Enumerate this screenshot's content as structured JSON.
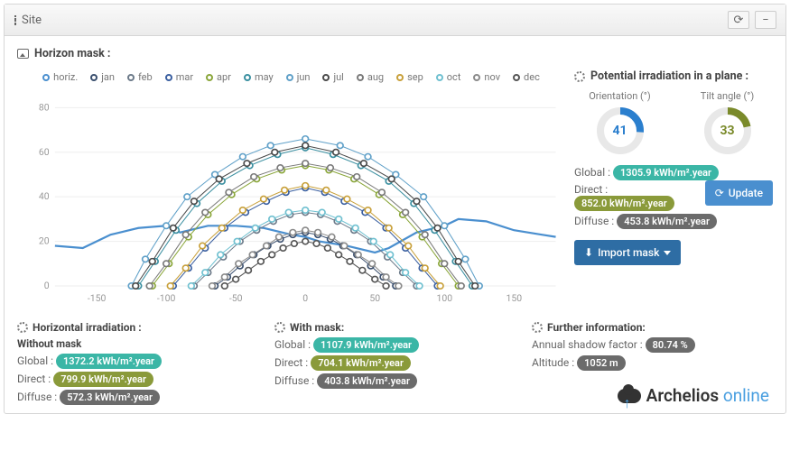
{
  "header": {
    "title": "Site"
  },
  "section_label": "Horizon mask :",
  "legend": [
    {
      "label": "horiz.",
      "color": "#4a8fcf"
    },
    {
      "label": "jan",
      "color": "#3a4f6e"
    },
    {
      "label": "feb",
      "color": "#6c7a89"
    },
    {
      "label": "mar",
      "color": "#3a5fa0"
    },
    {
      "label": "apr",
      "color": "#8aa63a"
    },
    {
      "label": "may",
      "color": "#3a8fa0"
    },
    {
      "label": "jun",
      "color": "#5fa0c8"
    },
    {
      "label": "jul",
      "color": "#4a4a4a"
    },
    {
      "label": "aug",
      "color": "#7a7a7a"
    },
    {
      "label": "sep",
      "color": "#c8a03a"
    },
    {
      "label": "oct",
      "color": "#6fc0d0"
    },
    {
      "label": "nov",
      "color": "#8a8a8a"
    },
    {
      "label": "dec",
      "color": "#555555"
    }
  ],
  "chart_data": {
    "type": "line",
    "xlabel": "",
    "ylabel": "",
    "xlim": [
      -180,
      180
    ],
    "ylim": [
      0,
      85
    ],
    "x_ticks": [
      -150,
      -100,
      -50,
      0,
      50,
      100,
      150
    ],
    "y_ticks": [
      0,
      20,
      40,
      60,
      80
    ],
    "series": [
      {
        "name": "horiz.",
        "color": "#4a8fcf",
        "style": "line",
        "x": [
          -180,
          -160,
          -140,
          -120,
          -100,
          -90,
          -70,
          -50,
          -30,
          -10,
          0,
          10,
          30,
          50,
          60,
          80,
          100,
          110,
          130,
          150,
          170,
          180
        ],
        "y": [
          18,
          17,
          23,
          26,
          27,
          24,
          27,
          27,
          26,
          23,
          22,
          20,
          18,
          15,
          17,
          24,
          27,
          30,
          29,
          25,
          23,
          22
        ]
      },
      {
        "name": "jun",
        "color": "#5fa0c8",
        "style": "markers",
        "x": [
          -125,
          -115,
          -100,
          -85,
          -65,
          -45,
          -25,
          0,
          25,
          45,
          65,
          85,
          100,
          115,
          125
        ],
        "y": [
          0,
          12,
          27,
          40,
          50,
          58,
          63,
          66,
          63,
          58,
          50,
          40,
          27,
          12,
          0
        ]
      },
      {
        "name": "may",
        "color": "#3a8fa0",
        "style": "markers",
        "x": [
          -120,
          -108,
          -93,
          -78,
          -60,
          -40,
          -20,
          0,
          20,
          40,
          60,
          78,
          93,
          108,
          120
        ],
        "y": [
          0,
          11,
          25,
          37,
          47,
          54,
          59,
          62,
          59,
          54,
          47,
          37,
          25,
          11,
          0
        ]
      },
      {
        "name": "jul",
        "color": "#4a4a4a",
        "style": "markers",
        "x": [
          -122,
          -110,
          -95,
          -80,
          -62,
          -42,
          -22,
          0,
          22,
          42,
          62,
          80,
          95,
          110,
          122
        ],
        "y": [
          0,
          11,
          26,
          38,
          48,
          55,
          60,
          63,
          60,
          55,
          48,
          38,
          26,
          11,
          0
        ]
      },
      {
        "name": "apr",
        "color": "#8aa63a",
        "style": "markers",
        "x": [
          -110,
          -98,
          -84,
          -70,
          -53,
          -35,
          -17,
          0,
          17,
          35,
          53,
          70,
          84,
          98,
          110
        ],
        "y": [
          0,
          10,
          22,
          32,
          41,
          48,
          52,
          54,
          52,
          48,
          41,
          32,
          22,
          10,
          0
        ]
      },
      {
        "name": "aug",
        "color": "#7a7a7a",
        "style": "markers",
        "x": [
          -112,
          -100,
          -86,
          -72,
          -55,
          -37,
          -18,
          0,
          18,
          37,
          55,
          72,
          86,
          100,
          112
        ],
        "y": [
          0,
          10,
          23,
          33,
          42,
          49,
          53,
          55,
          53,
          49,
          42,
          33,
          23,
          10,
          0
        ]
      },
      {
        "name": "mar",
        "color": "#3a5fa0",
        "style": "markers",
        "x": [
          -95,
          -84,
          -72,
          -58,
          -43,
          -28,
          -14,
          0,
          14,
          28,
          43,
          58,
          72,
          84,
          95
        ],
        "y": [
          0,
          8,
          17,
          26,
          33,
          38,
          42,
          44,
          42,
          38,
          33,
          26,
          17,
          8,
          0
        ]
      },
      {
        "name": "sep",
        "color": "#c8a03a",
        "style": "markers",
        "x": [
          -97,
          -86,
          -74,
          -60,
          -45,
          -30,
          -15,
          0,
          15,
          30,
          45,
          60,
          74,
          86,
          97
        ],
        "y": [
          0,
          8,
          18,
          26,
          34,
          39,
          43,
          45,
          43,
          39,
          34,
          26,
          18,
          8,
          0
        ]
      },
      {
        "name": "feb",
        "color": "#6c7a89",
        "style": "markers",
        "x": [
          -80,
          -70,
          -59,
          -47,
          -35,
          -23,
          -11,
          0,
          11,
          23,
          35,
          47,
          59,
          70,
          80
        ],
        "y": [
          0,
          6,
          13,
          20,
          25,
          29,
          32,
          33,
          32,
          29,
          25,
          20,
          13,
          6,
          0
        ]
      },
      {
        "name": "oct",
        "color": "#6fc0d0",
        "style": "markers",
        "x": [
          -82,
          -72,
          -61,
          -49,
          -36,
          -24,
          -12,
          0,
          12,
          24,
          36,
          49,
          61,
          72,
          82
        ],
        "y": [
          0,
          6,
          14,
          20,
          26,
          30,
          33,
          34,
          33,
          30,
          26,
          20,
          14,
          6,
          0
        ]
      },
      {
        "name": "jan",
        "color": "#3a4f6e",
        "style": "markers",
        "x": [
          -65,
          -56,
          -47,
          -37,
          -27,
          -18,
          -9,
          0,
          9,
          18,
          27,
          37,
          47,
          56,
          65
        ],
        "y": [
          0,
          4,
          9,
          14,
          18,
          21,
          23,
          24,
          23,
          21,
          18,
          14,
          9,
          4,
          0
        ]
      },
      {
        "name": "nov",
        "color": "#8a8a8a",
        "style": "markers",
        "x": [
          -67,
          -58,
          -48,
          -38,
          -28,
          -19,
          -9,
          0,
          9,
          19,
          28,
          38,
          48,
          58,
          67
        ],
        "y": [
          0,
          4,
          10,
          14,
          18,
          22,
          24,
          25,
          24,
          22,
          18,
          14,
          10,
          4,
          0
        ]
      },
      {
        "name": "dec",
        "color": "#555555",
        "style": "markers",
        "x": [
          -58,
          -50,
          -41,
          -32,
          -24,
          -16,
          -8,
          0,
          8,
          16,
          24,
          32,
          41,
          50,
          58
        ],
        "y": [
          0,
          3,
          7,
          11,
          14,
          17,
          19,
          20,
          19,
          17,
          14,
          11,
          7,
          3,
          0
        ]
      }
    ]
  },
  "side": {
    "title": "Potential irradiation in a plane :",
    "orientation_label": "Orientation (°)",
    "orientation_val": "41",
    "tilt_label": "Tilt angle (°)",
    "tilt_val": "33",
    "global_label": "Global :",
    "global_val": "1305.9 kWh/m².year",
    "direct_label": "Direct :",
    "direct_val": "852.0 kWh/m².year",
    "diffuse_label": "Diffuse :",
    "diffuse_val": "453.8 kWh/m².year",
    "update_btn": "Update",
    "import_btn": "Import mask"
  },
  "bottom": {
    "h1": "Horizontal irradiation :",
    "h1_sub": "Without mask",
    "h1_global": "1372.2 kWh/m².year",
    "h1_direct": "799.9 kWh/m².year",
    "h1_diffuse": "572.3 kWh/m².year",
    "h2": "With mask:",
    "h2_global": "1107.9 kWh/m².year",
    "h2_direct": "704.1 kWh/m².year",
    "h2_diffuse": "403.8 kWh/m².year",
    "h3": "Further information:",
    "shadow_label": "Annual shadow factor :",
    "shadow_val": "80.74 %",
    "alt_label": "Altitude :",
    "alt_val": "1052 m",
    "g": "Global :",
    "d": "Direct :",
    "f": "Diffuse :"
  },
  "brand": {
    "a": "Archelios",
    "b": " online"
  }
}
